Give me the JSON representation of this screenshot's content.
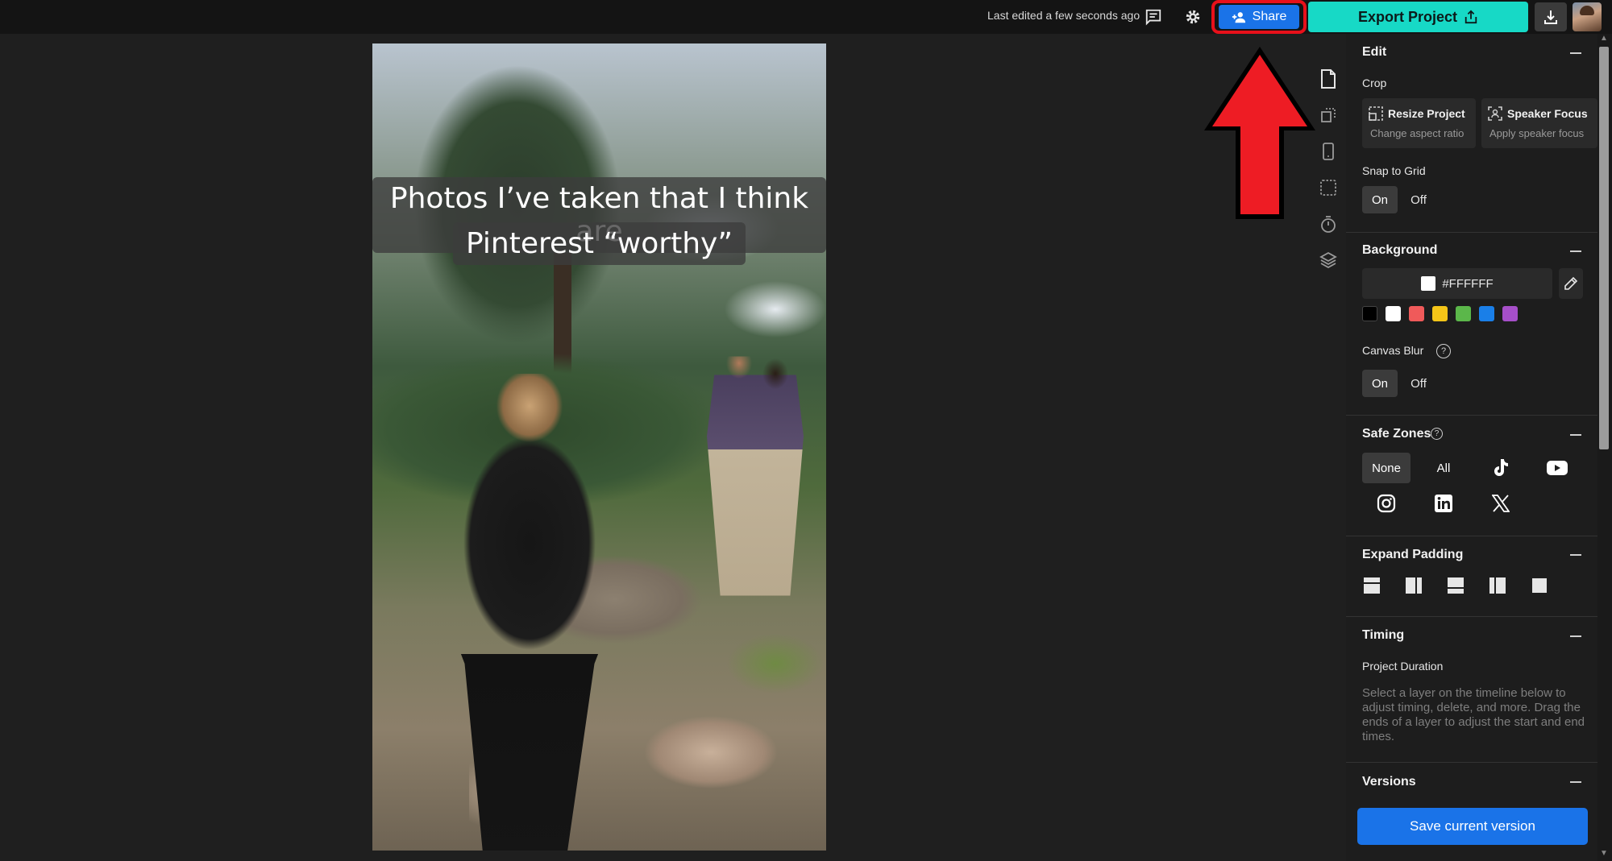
{
  "topbar": {
    "last_edited": "Last edited a few seconds ago",
    "share_label": "Share",
    "export_label": "Export Project"
  },
  "canvas": {
    "caption_line1": "Photos I’ve taken that I think are",
    "caption_line2": "Pinterest “worthy”"
  },
  "icon_rail": [
    "document-icon",
    "resize-icon",
    "phone-icon",
    "grid-icon",
    "timer-icon",
    "layers-icon"
  ],
  "panel": {
    "edit": {
      "title": "Edit",
      "crop_label": "Crop",
      "resize_title": "Resize Project",
      "resize_sub": "Change aspect ratio",
      "speaker_title": "Speaker Focus",
      "speaker_sub": "Apply speaker focus",
      "snap_label": "Snap to Grid",
      "on": "On",
      "off": "Off"
    },
    "background": {
      "title": "Background",
      "hex": "#FFFFFF",
      "swatches": [
        "#000000",
        "#FFFFFF",
        "#F05A5A",
        "#F5C518",
        "#5BB74A",
        "#1A7FE8",
        "#A64FC9"
      ],
      "canvas_blur_label": "Canvas Blur",
      "on": "On",
      "off": "Off"
    },
    "safe_zones": {
      "title": "Safe Zones",
      "none": "None",
      "all": "All",
      "platforms": [
        "tiktok-icon",
        "youtube-icon",
        "instagram-icon",
        "linkedin-icon",
        "x-icon"
      ]
    },
    "expand_padding": {
      "title": "Expand Padding"
    },
    "timing": {
      "title": "Timing",
      "project_duration": "Project Duration",
      "description": "Select a layer on the timeline below to adjust timing, delete, and more. Drag the ends of a layer to adjust the start and end times."
    },
    "versions": {
      "title": "Versions",
      "save_label": "Save current version"
    }
  },
  "colors": {
    "share_blue": "#1A73E8",
    "export_teal": "#17D9C6",
    "highlight_red": "#E8101A"
  }
}
